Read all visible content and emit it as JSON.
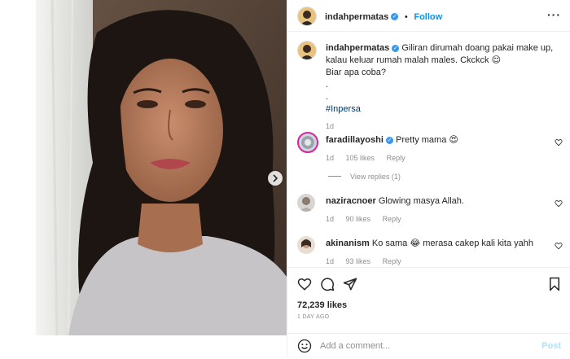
{
  "post": {
    "author": "indahpermatas",
    "follow_label": "Follow",
    "caption_line1": "Giliran dirumah doang pakai make up, kalau keluar rumah malah males. Ckckck 😌",
    "caption_line2": "Biar apa coba?",
    "caption_dot1": ".",
    "caption_dot2": ".",
    "hashtag": "#Inpersa",
    "caption_time": "1d",
    "likes": "72,239 likes",
    "time_ago": "1 DAY AGO"
  },
  "comments": [
    {
      "user": "faradillayoshi",
      "text": "Pretty mama 😍",
      "time": "1d",
      "likes": "105 likes",
      "reply": "Reply",
      "view_replies": "View replies (1)"
    },
    {
      "user": "naziracnoer",
      "text": "Glowing masya Allah.",
      "time": "1d",
      "likes": "90 likes",
      "reply": "Reply"
    },
    {
      "user": "akinanism",
      "text": "Ko sama 😂 merasa cakep kali kita yahh",
      "time": "1d",
      "likes": "93 likes",
      "reply": "Reply"
    }
  ],
  "comment_box": {
    "placeholder": "Add a comment...",
    "post_label": "Post"
  },
  "icons": {
    "verified": "verified-badge-icon",
    "like": "heart-icon",
    "comment": "comment-icon",
    "share": "paper-plane-icon",
    "save": "bookmark-icon",
    "emoji": "emoji-icon",
    "next": "chevron-right-icon",
    "more": "more-options-icon"
  },
  "colors": {
    "accent": "#0095f6",
    "muted": "#8e8e8e",
    "text": "#262626"
  }
}
